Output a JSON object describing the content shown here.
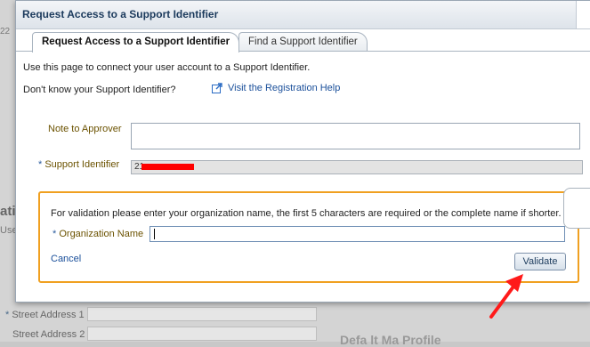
{
  "background": {
    "snippet_top": "22",
    "snippet_heading": "ati",
    "snippet_use": "Use",
    "street1_label": "Street Address 1",
    "street2_label": "Street Address 2",
    "required_mark": "*",
    "bottom_heading": "Defa lt Ma  Profile"
  },
  "dialog": {
    "title": "Request Access to a Support Identifier",
    "tabs": [
      {
        "label": "Request Access to a Support Identifier"
      },
      {
        "label": "Find a Support Identifier"
      }
    ],
    "intro_text": "Use this page to connect your user account to a Support Identifier.",
    "dont_know_text": "Don't know your Support Identifier?",
    "registration_link": "Visit the Registration Help",
    "note_label": "Note to Approver",
    "note_value": "",
    "support_id_label": "Support Identifier",
    "required_mark": "*",
    "support_id_value": "21",
    "validation": {
      "message": "For validation please enter your organization name, the first 5 characters are required or the complete name if shorter.",
      "org_label": "Organization Name",
      "org_value": "",
      "cancel_label": "Cancel",
      "validate_label": "Validate"
    }
  },
  "colors": {
    "accent_orange": "#f0a020",
    "link_blue": "#1a4f9a",
    "label_brown": "#6b5200",
    "redaction_red": "#ff0000"
  }
}
